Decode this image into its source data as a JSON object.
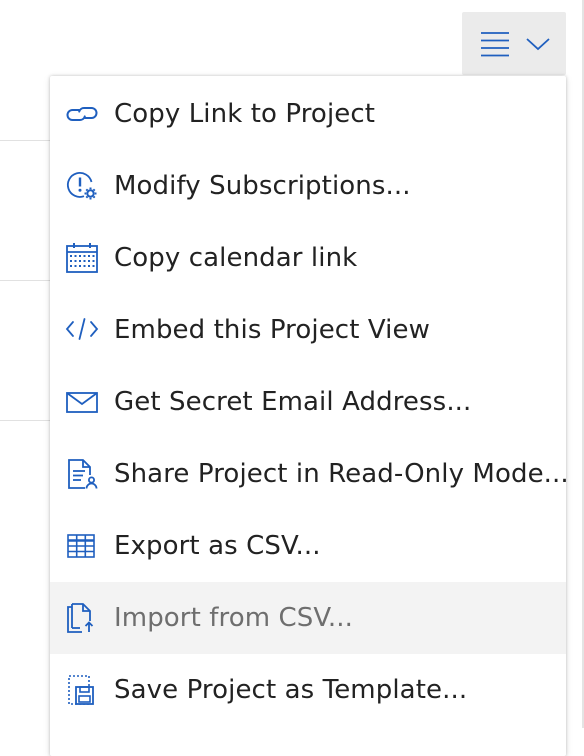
{
  "menu_button": {
    "icon": "hamburger-icon",
    "dropdown_icon": "chevron-down-icon"
  },
  "dropdown": {
    "items": [
      {
        "label": "Copy Link to Project",
        "icon": "link-icon"
      },
      {
        "label": "Modify Subscriptions...",
        "icon": "subscription-gear-icon"
      },
      {
        "label": "Copy calendar link",
        "icon": "calendar-icon"
      },
      {
        "label": "Embed this Project View",
        "icon": "code-icon"
      },
      {
        "label": "Get Secret Email Address...",
        "icon": "envelope-icon"
      },
      {
        "label": "Share Project in Read-Only Mode...",
        "icon": "share-document-icon"
      },
      {
        "label": "Export as CSV...",
        "icon": "table-grid-icon"
      },
      {
        "label": "Import from CSV...",
        "icon": "import-document-icon",
        "hovered": true
      },
      {
        "label": "Save Project as Template...",
        "icon": "save-template-icon"
      }
    ]
  },
  "colors": {
    "icon_blue": "#1f5fbf",
    "text": "#222222",
    "hover_bg": "#f3f3f3",
    "trigger_bg": "#ebebeb"
  }
}
